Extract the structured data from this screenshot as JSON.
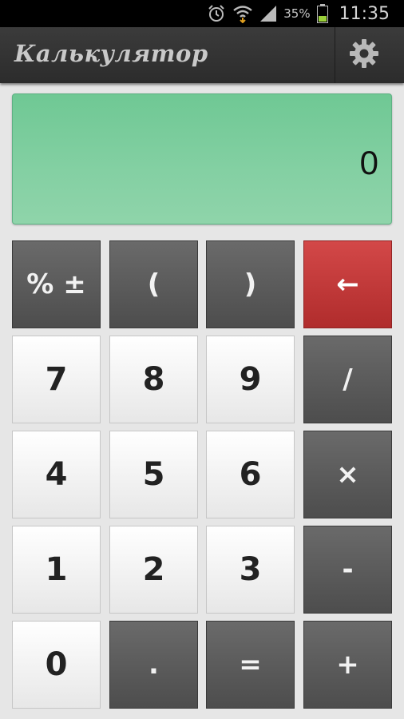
{
  "status_bar": {
    "battery_percent": "35%",
    "time": "11:35",
    "icons": [
      "alarm-icon",
      "wifi-icon",
      "signal-icon",
      "battery-icon"
    ]
  },
  "app_bar": {
    "title": "Калькулятор",
    "settings_icon": "gear-icon"
  },
  "display": {
    "value": "0",
    "background_color": "#80cfa0"
  },
  "keys": {
    "percent_sign": "% ±",
    "open_paren": "(",
    "close_paren": ")",
    "backspace": "←",
    "k7": "7",
    "k8": "8",
    "k9": "9",
    "divide": "/",
    "k4": "4",
    "k5": "5",
    "k6": "6",
    "multiply": "×",
    "k1": "1",
    "k2": "2",
    "k3": "3",
    "minus": "-",
    "k0": "0",
    "decimal": ".",
    "equals": "=",
    "plus": "+"
  },
  "colors": {
    "accent_red": "#c23a3a",
    "dark_key": "#5a5a5a",
    "light_key": "#f4f4f4",
    "app_bar": "#333333"
  }
}
